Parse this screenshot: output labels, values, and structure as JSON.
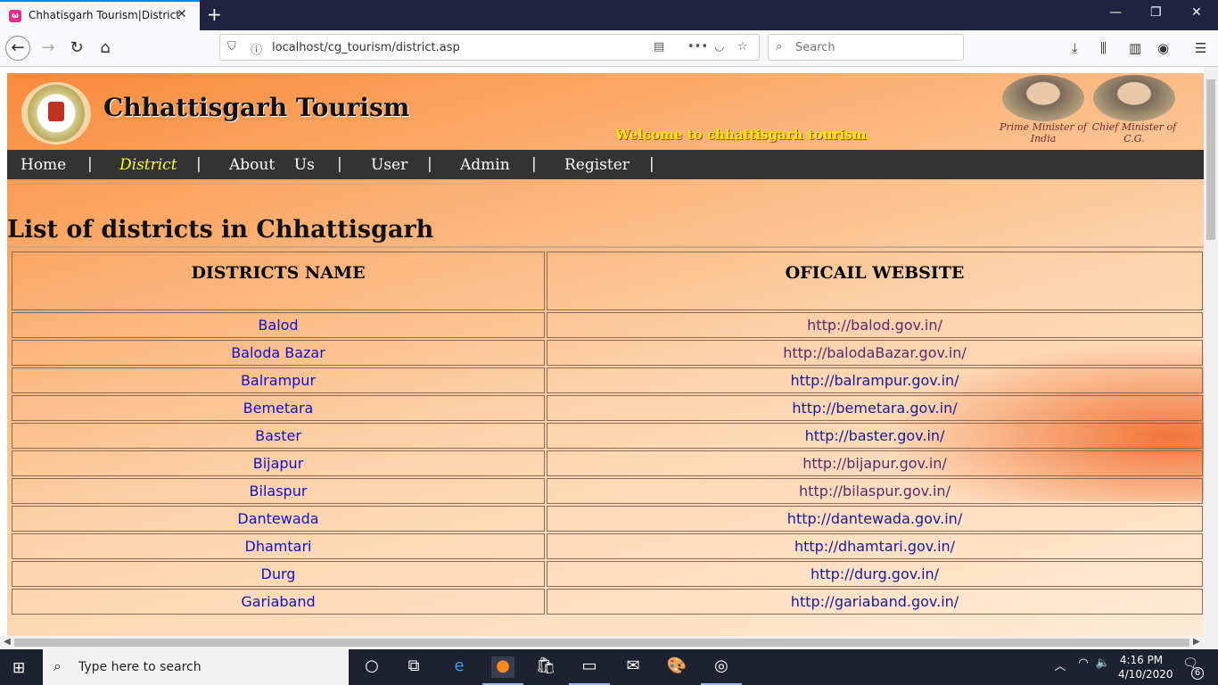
{
  "browser": {
    "tab_title": "Chhatisgarh Tourism|District",
    "url": "localhost/cg_tourism/district.asp",
    "search_placeholder": "Search"
  },
  "header": {
    "site_title": "Chhattisgarh Tourism",
    "welcome": "Welcome to chhattisgarh tourism",
    "leaders": [
      {
        "caption": "Prime Minister of India"
      },
      {
        "caption": "Chief Minister of C.G."
      }
    ]
  },
  "menu": {
    "items": [
      {
        "label": "Home"
      },
      {
        "label": "District"
      },
      {
        "label": "About    Us"
      },
      {
        "label": "User"
      },
      {
        "label": "Admin"
      },
      {
        "label": "Register"
      }
    ],
    "separator": "|"
  },
  "main": {
    "heading": "List of districts in Chhattisgarh",
    "table": {
      "columns": [
        "DISTRICTS NAME",
        "OFICAIL WEBSITE"
      ],
      "rows": [
        {
          "name": "Balod",
          "site": "http://balod.gov.in/"
        },
        {
          "name": "Baloda Bazar",
          "site": "http://balodaBazar.gov.in/"
        },
        {
          "name": "Balrampur",
          "site": "http://balrampur.gov.in/"
        },
        {
          "name": "Bemetara",
          "site": "http://bemetara.gov.in/"
        },
        {
          "name": "Baster",
          "site": "http://baster.gov.in/"
        },
        {
          "name": "Bijapur",
          "site": "http://bijapur.gov.in/"
        },
        {
          "name": "Bilaspur",
          "site": "http://bilaspur.gov.in/"
        },
        {
          "name": "Dantewada",
          "site": "http://dantewada.gov.in/"
        },
        {
          "name": "Dhamtari",
          "site": "http://dhamtari.gov.in/"
        },
        {
          "name": "Durg",
          "site": "http://durg.gov.in/"
        },
        {
          "name": "Gariaband",
          "site": "http://gariaband.gov.in/"
        }
      ]
    }
  },
  "taskbar": {
    "search_placeholder": "Type here to search",
    "time": "4:16 PM",
    "date": "4/10/2020",
    "notifications": "6"
  }
}
